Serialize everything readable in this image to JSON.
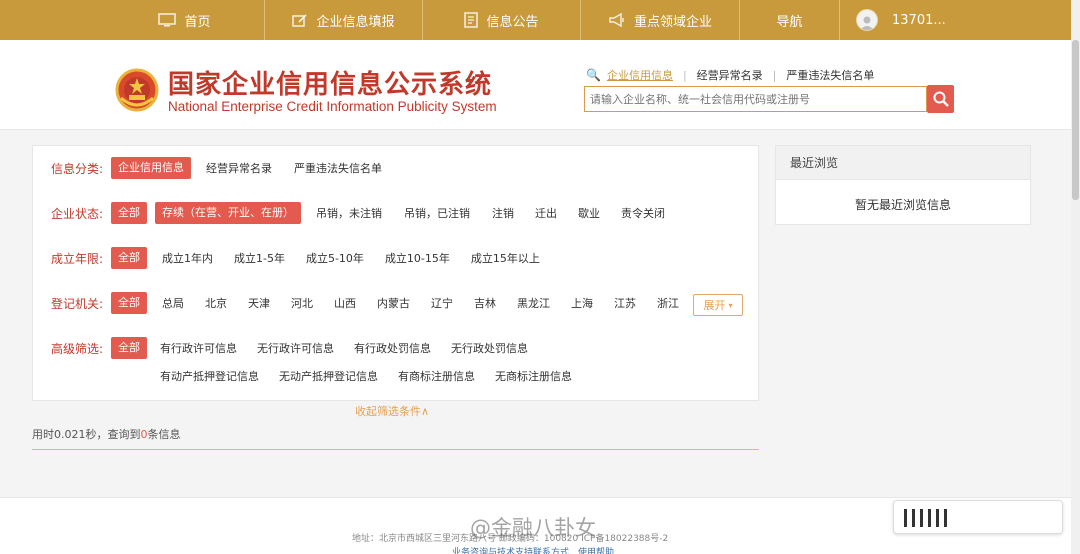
{
  "nav": {
    "items": [
      "首页",
      "企业信息填报",
      "信息公告",
      "重点领域企业",
      "导航"
    ],
    "user": "13701..."
  },
  "header": {
    "title": "国家企业信用信息公示系统",
    "subtitle": "National Enterprise Credit Information Publicity System",
    "search_tabs": [
      "企业信用信息",
      "经营异常名录",
      "严重违法失信名单"
    ],
    "search_placeholder": "请输入企业名称、统一社会信用代码或注册号"
  },
  "filters": {
    "info_category": {
      "label": "信息分类:",
      "options": [
        "企业信用信息",
        "经营异常名录",
        "严重违法失信名单"
      ]
    },
    "status": {
      "label": "企业状态:",
      "options": [
        "全部",
        "存续（在营、开业、在册）",
        "吊销，未注销",
        "吊销，已注销",
        "注销",
        "迁出",
        "歇业",
        "责令关闭"
      ]
    },
    "established": {
      "label": "成立年限:",
      "options": [
        "全部",
        "成立1年内",
        "成立1-5年",
        "成立5-10年",
        "成立10-15年",
        "成立15年以上"
      ]
    },
    "authority": {
      "label": "登记机关:",
      "options": [
        "全部",
        "总局",
        "北京",
        "天津",
        "河北",
        "山西",
        "内蒙古",
        "辽宁",
        "吉林",
        "黑龙江",
        "上海",
        "江苏",
        "浙江"
      ],
      "expand": "展开"
    },
    "advanced": {
      "label": "高级筛选:",
      "options_row1": [
        "全部",
        "有行政许可信息",
        "无行政许可信息",
        "有行政处罚信息",
        "无行政处罚信息"
      ],
      "options_row2": [
        "有动产抵押登记信息",
        "无动产抵押登记信息",
        "有商标注册信息",
        "无商标注册信息"
      ]
    },
    "collapse": "收起筛选条件∧"
  },
  "result": {
    "prefix": "用时0.021秒，查询到",
    "count": "0",
    "suffix": "条信息"
  },
  "recent": {
    "title": "最近浏览",
    "empty": "暂无最近浏览信息"
  },
  "footer": {
    "address": "地址：北京市西城区三里河东路八号 邮政编码：100820 ICP备18022388号-2",
    "links": "业务咨询与技术支持联系方式　使用帮助"
  },
  "watermark": "@金融八卦女",
  "colors": {
    "gold": "#c99a3c",
    "red": "#e35a4e",
    "title_red": "#c0392b"
  }
}
